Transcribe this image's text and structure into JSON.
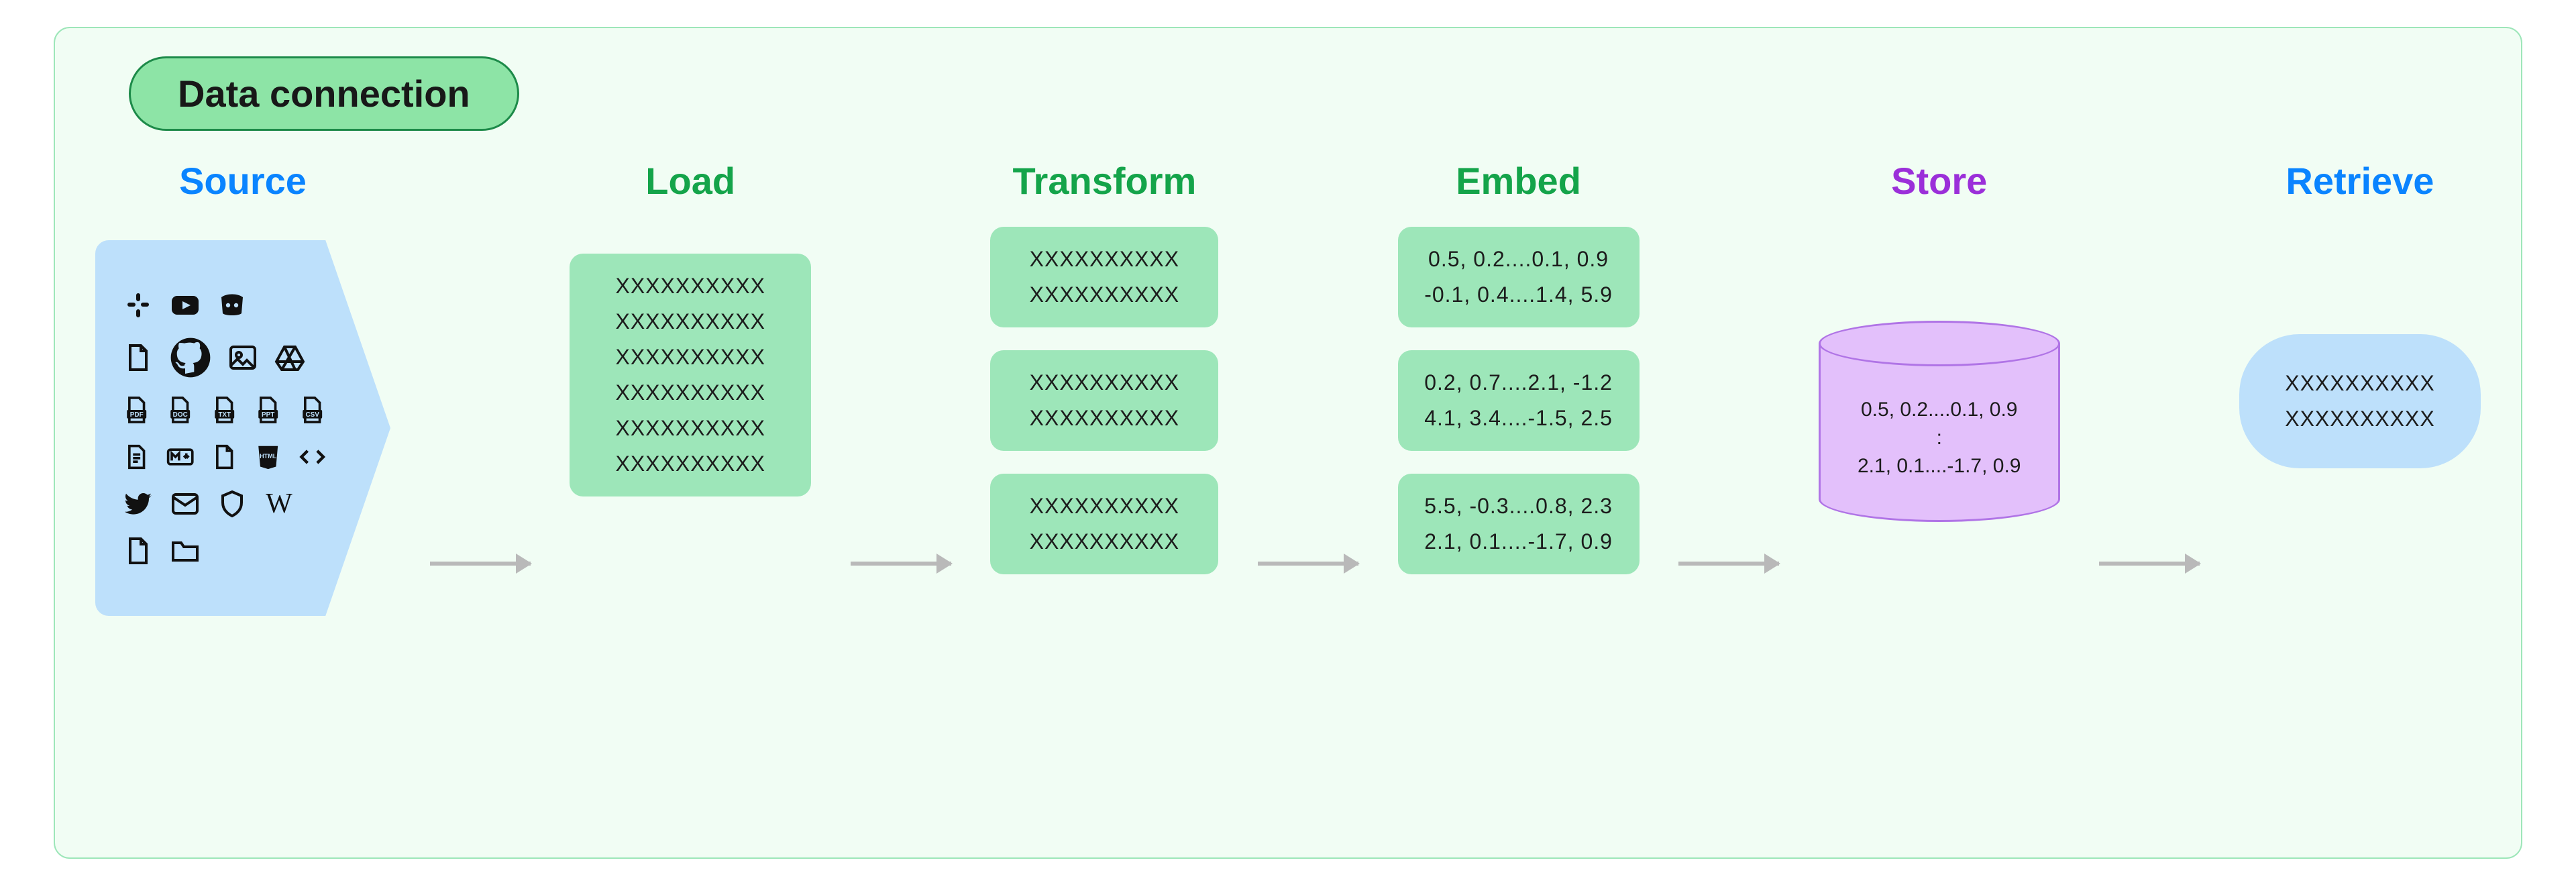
{
  "badge": "Data connection",
  "stages": {
    "source": {
      "title": "Source"
    },
    "load": {
      "title": "Load",
      "lines": [
        "XXXXXXXXXX",
        "XXXXXXXXXX",
        "XXXXXXXXXX",
        "XXXXXXXXXX",
        "XXXXXXXXXX",
        "XXXXXXXXXX"
      ]
    },
    "transform": {
      "title": "Transform",
      "blocks": [
        [
          "XXXXXXXXXX",
          "XXXXXXXXXX"
        ],
        [
          "XXXXXXXXXX",
          "XXXXXXXXXX"
        ],
        [
          "XXXXXXXXXX",
          "XXXXXXXXXX"
        ]
      ]
    },
    "embed": {
      "title": "Embed",
      "blocks": [
        [
          "0.5, 0.2....0.1, 0.9",
          "-0.1, 0.4....1.4, 5.9"
        ],
        [
          "0.2, 0.7....2.1, -1.2",
          "4.1, 3.4....-1.5, 2.5"
        ],
        [
          "5.5, -0.3....0.8, 2.3",
          "2.1, 0.1....-1.7, 0.9"
        ]
      ]
    },
    "store": {
      "title": "Store",
      "lines": [
        "0.5, 0.2....0.1, 0.9",
        ":",
        "2.1, 0.1....-1.7, 0.9"
      ]
    },
    "retrieve": {
      "title": "Retrieve",
      "lines": [
        "XXXXXXXXXX",
        "XXXXXXXXXX"
      ]
    }
  },
  "icons": {
    "source_grid": [
      [
        "slack-icon",
        "youtube-icon",
        "discord-icon"
      ],
      [
        "file-icon",
        "github-icon",
        "image-icon",
        "google-drive-icon"
      ],
      [
        "file-pdf-icon",
        "file-doc-icon",
        "file-txt-icon",
        "file-ppt-icon",
        "file-csv-icon"
      ],
      [
        "page-icon",
        "markdown-icon",
        "file-icon",
        "html-icon",
        "code-icon"
      ],
      [
        "twitter-icon",
        "mail-icon",
        "shield-icon",
        "wikipedia-icon"
      ],
      [
        "file-icon",
        "folder-icon"
      ]
    ]
  },
  "colors": {
    "frame_bg": "#f1fdf4",
    "frame_border": "#9de6b9",
    "badge_bg": "#8de4a6",
    "badge_border": "#1d8a49",
    "blue": "#0a84ff",
    "green_title": "#14a44a",
    "green_card": "#9de6b9",
    "purple": "#9b2fd9",
    "purple_fill": "#e3c0fb",
    "source_bg": "#bde0fb",
    "arrow": "#b9b9b9"
  }
}
